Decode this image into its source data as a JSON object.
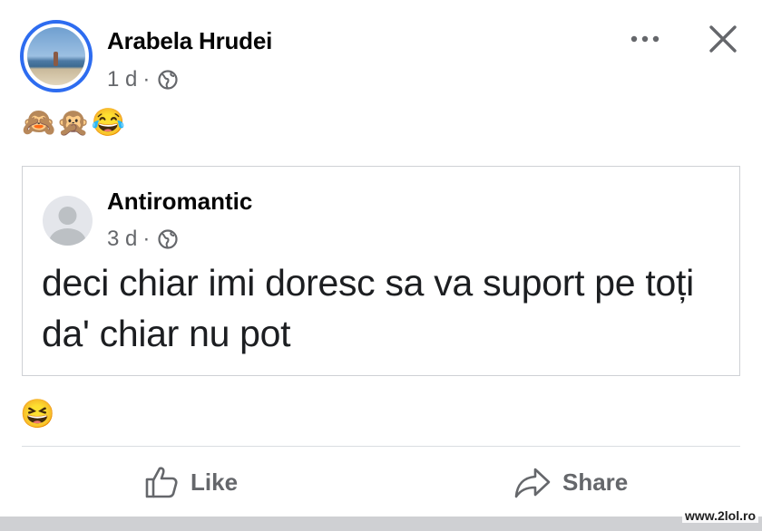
{
  "post": {
    "author_name": "Arabela Hrudei",
    "time": "1 d",
    "separator": "·",
    "privacy_icon": "globe-icon",
    "reaction_text": "🙈🙊😂",
    "header_icons": [
      "more-icon",
      "close-icon"
    ]
  },
  "shared_post": {
    "author_name": "Antiromantic",
    "time": "3 d",
    "separator": "·",
    "privacy_icon": "globe-icon",
    "text": "deci chiar imi doresc sa va suport pe toți da' chiar nu pot"
  },
  "reactions": {
    "emoji": "😆"
  },
  "actions": {
    "like_label": "Like",
    "share_label": "Share"
  },
  "watermark": "www.2lol.ro",
  "colors": {
    "accent_ring": "#2d6cf0",
    "secondary_text": "#65676b",
    "card_border": "#cfd1d5"
  }
}
